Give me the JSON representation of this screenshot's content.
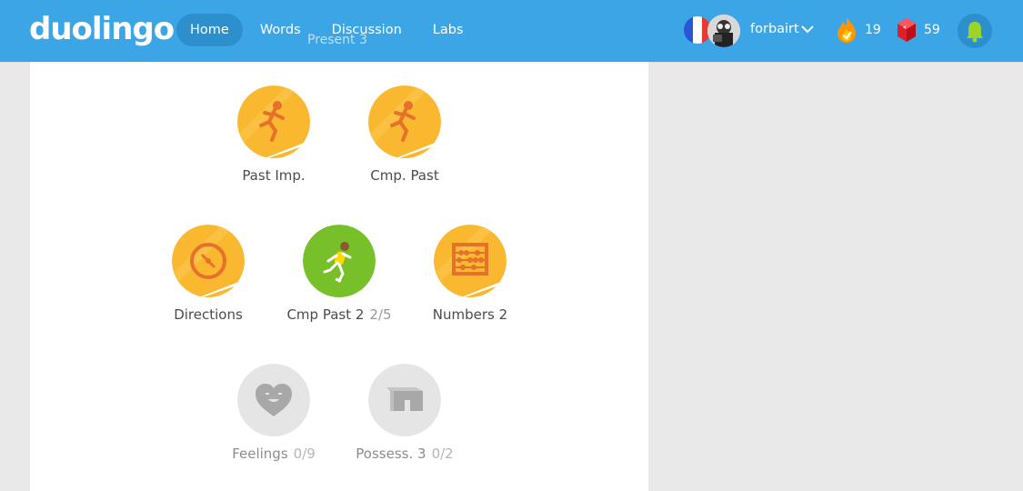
{
  "nav": {
    "logo": "duolingo",
    "items": [
      {
        "label": "Home",
        "active": true
      },
      {
        "label": "Words",
        "active": false
      },
      {
        "label": "Discussion",
        "active": false
      },
      {
        "label": "Labs",
        "active": false
      }
    ]
  },
  "user": {
    "language_flag": "french-flag-icon",
    "username": "forbairt",
    "streak": "19",
    "lingots": "59"
  },
  "ghost_text": "Present 3",
  "skills": [
    {
      "label": "Past Imp.",
      "progress": "",
      "state": "gold",
      "icon": "running-person-icon"
    },
    {
      "label": "Cmp. Past",
      "progress": "",
      "state": "gold",
      "icon": "running-person-icon"
    },
    {
      "label": "Directions",
      "progress": "",
      "state": "gold",
      "icon": "compass-icon"
    },
    {
      "label": "Cmp Past 2",
      "progress": "2/5",
      "state": "active",
      "icon": "running-person-icon"
    },
    {
      "label": "Numbers 2",
      "progress": "",
      "state": "gold",
      "icon": "abacus-icon"
    },
    {
      "label": "Feelings",
      "progress": "0/9",
      "state": "locked",
      "icon": "heart-face-icon"
    },
    {
      "label": "Possess. 3",
      "progress": "0/2",
      "state": "locked",
      "icon": "box-icon"
    }
  ],
  "colors": {
    "header": "#3ba5e6",
    "gold": "#f9b830",
    "active": "#78c02a",
    "locked": "#e5e5e5"
  }
}
